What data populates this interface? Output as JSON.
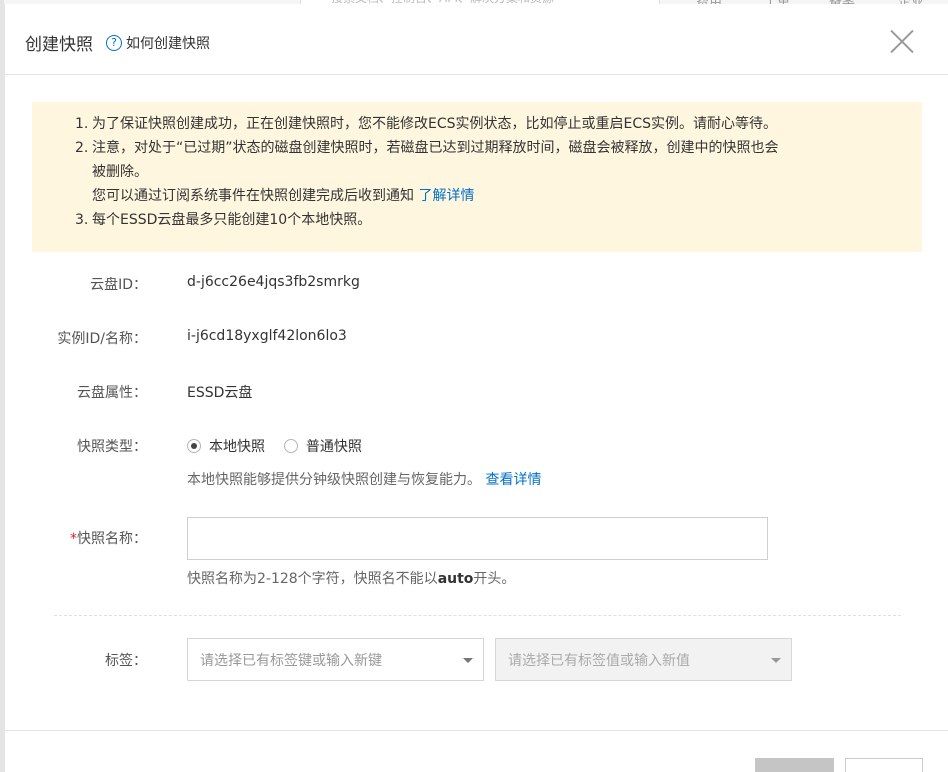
{
  "dialog": {
    "title": "创建快照",
    "help_link": "如何创建快照"
  },
  "notice": {
    "item1_num": "1.",
    "item1": "为了保证快照创建成功，正在创建快照时，您不能修改ECS实例状态，比如停止或重启ECS实例。请耐心等待。",
    "item2_num": "2.",
    "item2_line1": "注意，对处于“已过期”状态的磁盘创建快照时，若磁盘已达到过期释放时间，磁盘会被释放，创建中的快照也会",
    "item2_line2": "被删除。",
    "item2_line3": "您可以通过订阅系统事件在快照创建完成后收到通知",
    "item2_link": "了解详情",
    "item3_num": "3.",
    "item3": "每个ESSD云盘最多只能创建10个本地快照。"
  },
  "fields": {
    "disk_id_label": "云盘ID：",
    "disk_id_value": "d-j6cc26e4jqs3fb2smrkg",
    "instance_label": "实例ID/名称：",
    "instance_value": "i-j6cd18yxglf42lon6lo3",
    "disk_attr_label": "云盘属性：",
    "disk_attr_value": "ESSD云盘",
    "snapshot_type_label": "快照类型：",
    "type_local": "本地快照",
    "type_normal": "普通快照",
    "type_selected": "本地快照",
    "type_hint": "本地快照能够提供分钟级快照创建与恢复能力。",
    "type_hint_link": "查看详情",
    "name_required_mark": "*",
    "name_label": "快照名称：",
    "name_value": "",
    "name_hint_prefix": "快照名称为2-128个字符，快照名不能以",
    "name_hint_bold": "auto",
    "name_hint_suffix": "开头。",
    "tag_label": "标签：",
    "tag_key_placeholder": "请选择已有标签键或输入新键",
    "tag_value_placeholder": "请选择已有标签值或输入新值"
  },
  "background": {
    "search_placeholder": "搜索文档、控制台、API、解决方案和资源",
    "nav": [
      "费用",
      "工单",
      "备案",
      "企业"
    ]
  }
}
